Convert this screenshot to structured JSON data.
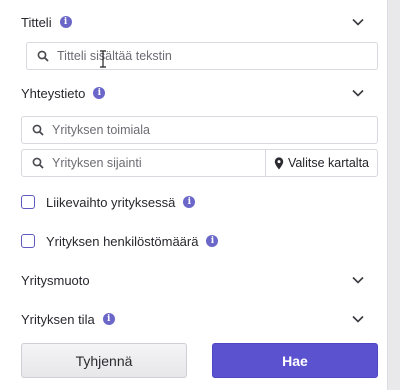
{
  "colors": {
    "accent": "#5a52cf",
    "info": "#6b67c9",
    "checkbox_border": "#5e5ac0"
  },
  "sections": {
    "title": {
      "label": "Titteli",
      "search_placeholder": "Titteli sisältää tekstin"
    },
    "contact": {
      "label": "Yhteystieto",
      "industry_placeholder": "Yrityksen toimiala",
      "location_placeholder": "Yrityksen sijainti",
      "map_button_label": "Valitse kartalta"
    },
    "revenue": {
      "label": "Liikevaihto yrityksessä",
      "checked": false
    },
    "headcount": {
      "label": "Yrityksen henkilöstömäärä",
      "checked": false
    },
    "company_form": {
      "label": "Yritysmuoto"
    },
    "company_status": {
      "label": "Yrityksen tila"
    }
  },
  "icons": {
    "info": "i",
    "info_icon": "info-icon",
    "chevron": "chevron-down-icon",
    "search": "search-icon",
    "pin": "map-pin-icon"
  },
  "actions": {
    "clear_label": "Tyhjennä",
    "search_label": "Hae"
  }
}
